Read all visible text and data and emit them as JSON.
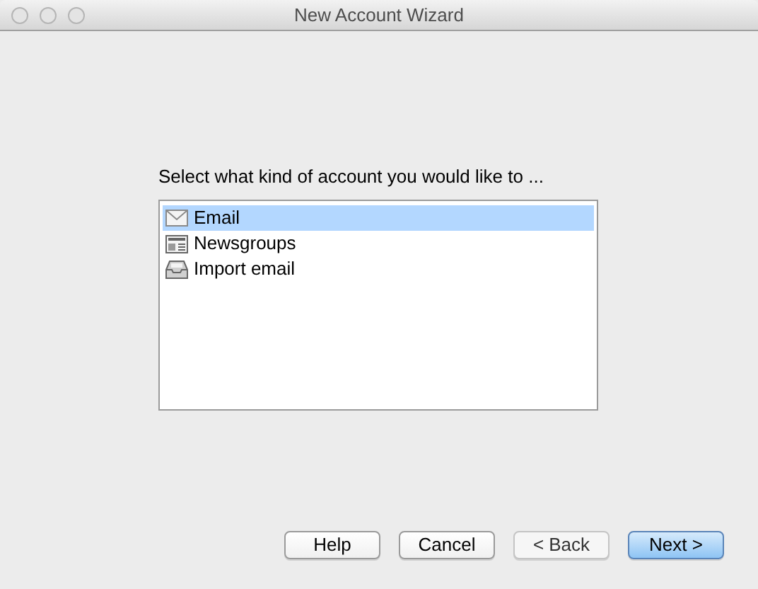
{
  "window": {
    "title": "New Account Wizard"
  },
  "prompt": "Select what kind of account you would like to ...",
  "account_types": [
    {
      "label": "Email",
      "kind": "envelope",
      "selected": true
    },
    {
      "label": "Newsgroups",
      "kind": "newspaper",
      "selected": false
    },
    {
      "label": "Import email",
      "kind": "tray",
      "selected": false
    }
  ],
  "buttons": [
    {
      "label": "Help",
      "default": false,
      "disabled": false
    },
    {
      "label": "Cancel",
      "default": false,
      "disabled": false
    },
    {
      "label": "< Back",
      "default": false,
      "disabled": true
    },
    {
      "label": "Next >",
      "default": true,
      "disabled": false
    }
  ]
}
